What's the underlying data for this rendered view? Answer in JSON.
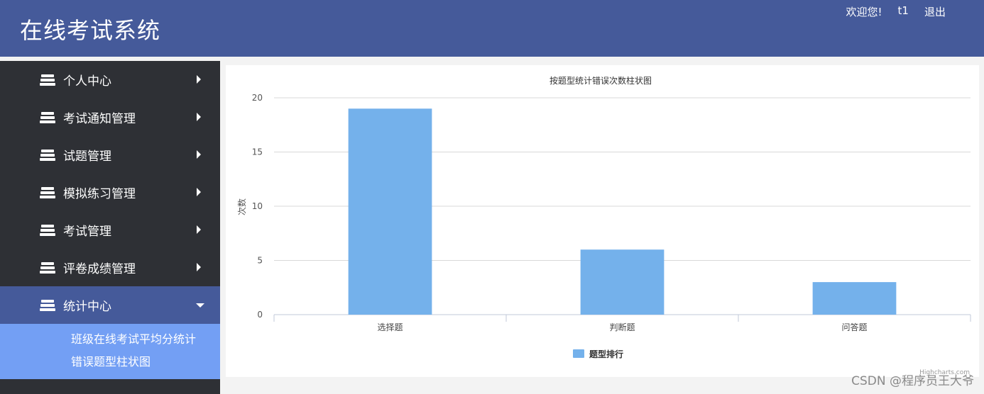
{
  "header": {
    "title": "在线考试系统",
    "welcome": "欢迎您!",
    "username": "t1",
    "logout": "退出"
  },
  "sidebar": {
    "items": [
      {
        "label": "个人中心",
        "expanded": false
      },
      {
        "label": "考试通知管理",
        "expanded": false
      },
      {
        "label": "试题管理",
        "expanded": false
      },
      {
        "label": "模拟练习管理",
        "expanded": false
      },
      {
        "label": "考试管理",
        "expanded": false
      },
      {
        "label": "评卷成绩管理",
        "expanded": false
      },
      {
        "label": "统计中心",
        "expanded": true
      }
    ],
    "subitems": [
      {
        "label": "班级在线考试平均分统计"
      },
      {
        "label": "错误题型柱状图"
      }
    ]
  },
  "chart_data": {
    "type": "bar",
    "title": "按题型统计错误次数柱状图",
    "xlabel": "",
    "ylabel": "次数",
    "categories": [
      "选择题",
      "判断题",
      "问答题"
    ],
    "series": [
      {
        "name": "题型排行",
        "values": [
          19,
          6,
          3
        ]
      }
    ],
    "ylim": [
      0,
      20
    ],
    "yticks": [
      0,
      5,
      10,
      15,
      20
    ],
    "grid": true,
    "legend": "bottom-center",
    "credits": "Highcharts.com",
    "bar_color": "#74b1eb"
  },
  "watermark": "CSDN @程序员王大爷",
  "colors": {
    "header": "#455a9a",
    "sidebar": "#2e3035",
    "active": "#455a9a",
    "submenu": "#739ff4"
  }
}
